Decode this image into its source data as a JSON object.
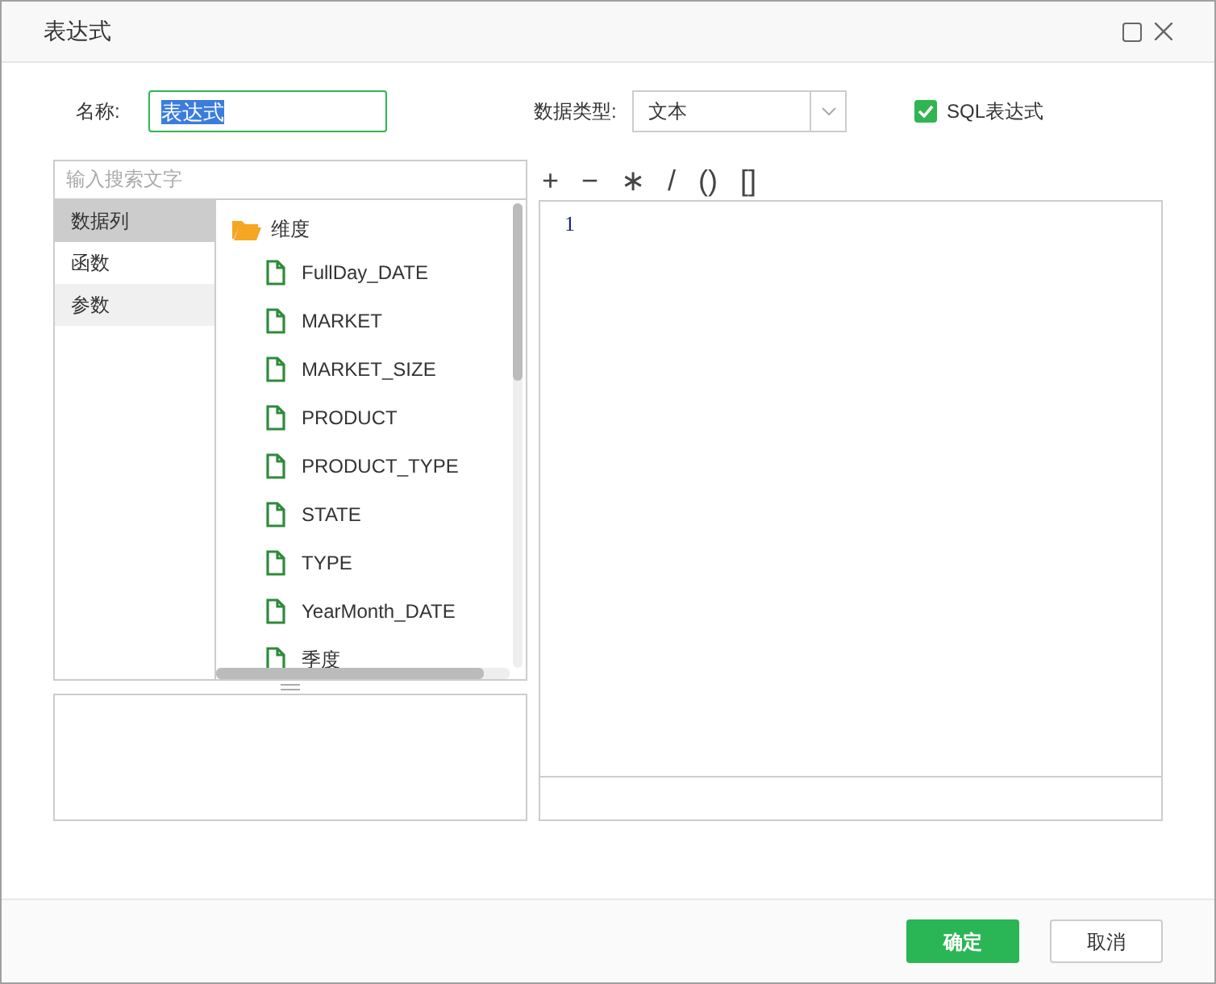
{
  "window": {
    "title": "表达式"
  },
  "name_field": {
    "label": "名称:",
    "value": "表达式"
  },
  "data_type": {
    "label": "数据类型:",
    "value": "文本"
  },
  "sql_option": {
    "label": "SQL表达式",
    "checked": true
  },
  "search": {
    "placeholder": "输入搜索文字"
  },
  "categories": [
    {
      "label": "数据列",
      "selected": true,
      "hovered": false
    },
    {
      "label": "函数",
      "selected": false,
      "hovered": false
    },
    {
      "label": "参数",
      "selected": false,
      "hovered": true
    }
  ],
  "tree": [
    {
      "label": "维度",
      "expanded": true,
      "children": [
        {
          "label": "FullDay_DATE"
        },
        {
          "label": "MARKET"
        },
        {
          "label": "MARKET_SIZE"
        },
        {
          "label": "PRODUCT"
        },
        {
          "label": "PRODUCT_TYPE"
        },
        {
          "label": "STATE"
        },
        {
          "label": "TYPE"
        },
        {
          "label": "YearMonth_DATE"
        },
        {
          "label": "季度"
        }
      ]
    }
  ],
  "operators": [
    "+",
    "−",
    "∗",
    "/",
    "()",
    "[]"
  ],
  "editor": {
    "line_numbers": [
      "1"
    ]
  },
  "buttons": [
    {
      "label": "确定",
      "kind": "primary"
    },
    {
      "label": "取消",
      "kind": "secondary"
    }
  ]
}
